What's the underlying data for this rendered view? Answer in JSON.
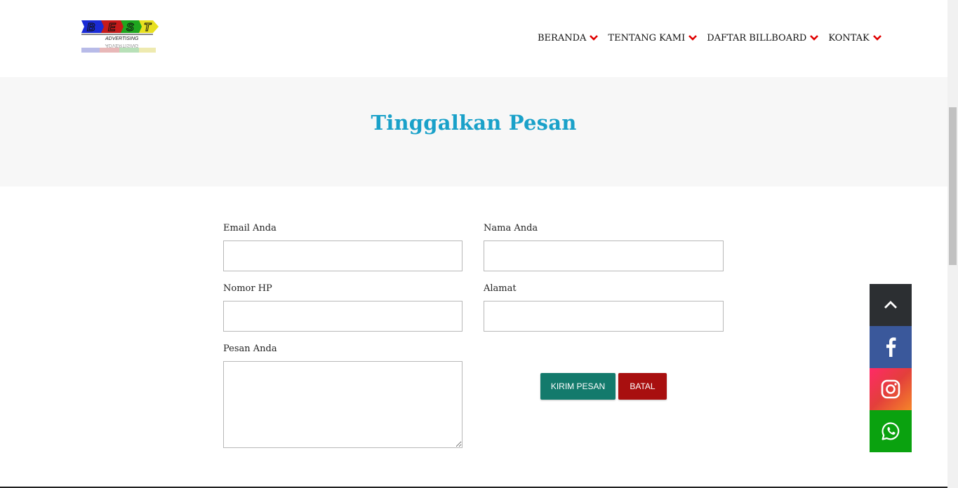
{
  "brand": {
    "logo_alt": "BEST ADVERTISING",
    "logo_letters": [
      "B",
      "E",
      "S",
      "T"
    ],
    "logo_subtitle": "ADVERTISING"
  },
  "nav": {
    "items": [
      {
        "label": "BERANDA"
      },
      {
        "label": "TENTANG KAMI"
      },
      {
        "label": "DAFTAR BILLBOARD"
      },
      {
        "label": "KONTAK"
      }
    ],
    "chevron_color": "#e00000"
  },
  "banner": {
    "title": "Tinggalkan Pesan",
    "title_color": "#1aa1c9"
  },
  "form": {
    "email_label": "Email Anda",
    "email_value": "",
    "name_label": "Nama Anda",
    "name_value": "",
    "phone_label": "Nomor HP",
    "phone_value": "",
    "address_label": "Alamat",
    "address_value": "",
    "message_label": "Pesan Anda",
    "message_value": "",
    "send_label": "KIRIM PESAN",
    "cancel_label": "BATAL"
  },
  "social": {
    "items": [
      {
        "name": "back-to-top",
        "icon": "chevron-up-icon",
        "color": "#2c2f32"
      },
      {
        "name": "facebook",
        "icon": "facebook-icon",
        "color": "#3a589b"
      },
      {
        "name": "instagram",
        "icon": "instagram-icon",
        "color": "#e33f3b"
      },
      {
        "name": "whatsapp",
        "icon": "whatsapp-icon",
        "color": "#0aa20f"
      }
    ]
  },
  "colors": {
    "send_button": "#137a6c",
    "cancel_button": "#a80f0f",
    "banner_bg": "#f7f7f7"
  }
}
